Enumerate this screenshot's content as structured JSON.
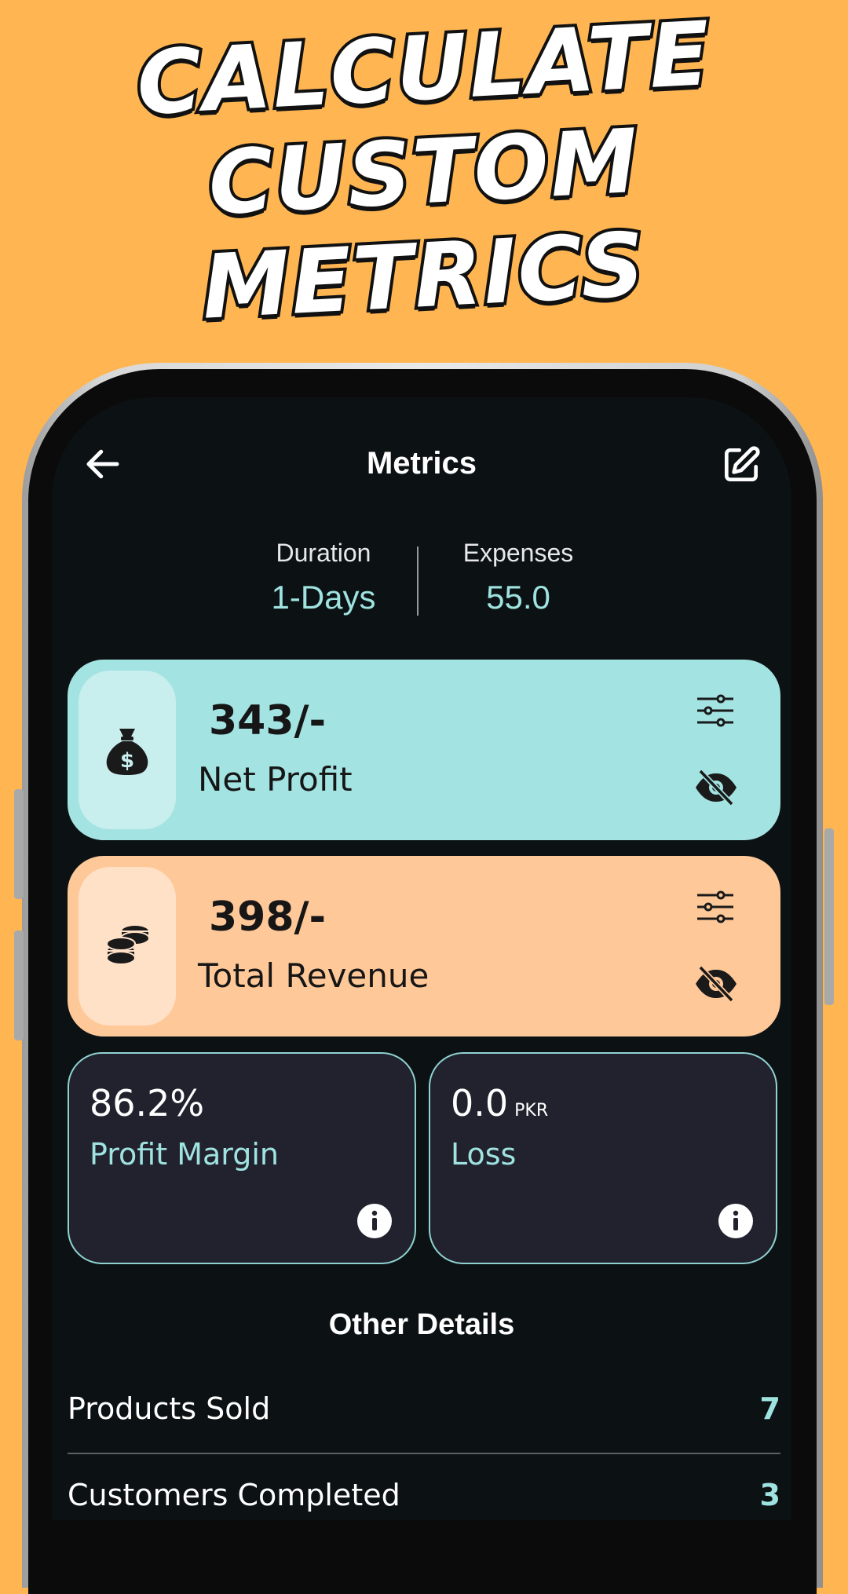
{
  "headline": {
    "lines": [
      "CALCULATE",
      "CUSTOM",
      "METRICS"
    ]
  },
  "appbar": {
    "title": "Metrics",
    "back_icon": "arrow-left-icon",
    "edit_icon": "edit-square-icon"
  },
  "summary": {
    "duration_label": "Duration",
    "duration_value": "1-Days",
    "expenses_label": "Expenses",
    "expenses_value": "55.0"
  },
  "cards": [
    {
      "amount": "343/-",
      "label": "Net Profit",
      "icon": "money-bag-icon",
      "color": "#A3E3E2"
    },
    {
      "amount": "398/-",
      "label": "Total Revenue",
      "icon": "coins-stack-icon",
      "color": "#FFC898"
    }
  ],
  "stats": [
    {
      "value": "86.2%",
      "unit": "",
      "label": "Profit Margin"
    },
    {
      "value": "0.0",
      "unit": "PKR",
      "label": "Loss"
    }
  ],
  "other_details": {
    "title": "Other Details",
    "rows": [
      {
        "label": "Products Sold",
        "value": "7"
      },
      {
        "label": "Customers Completed",
        "value": "3"
      }
    ]
  },
  "colors": {
    "background": "#FFB652",
    "screen": "#0C1214",
    "accent_teal": "#9FE3E1",
    "card_dark": "#22222F"
  }
}
